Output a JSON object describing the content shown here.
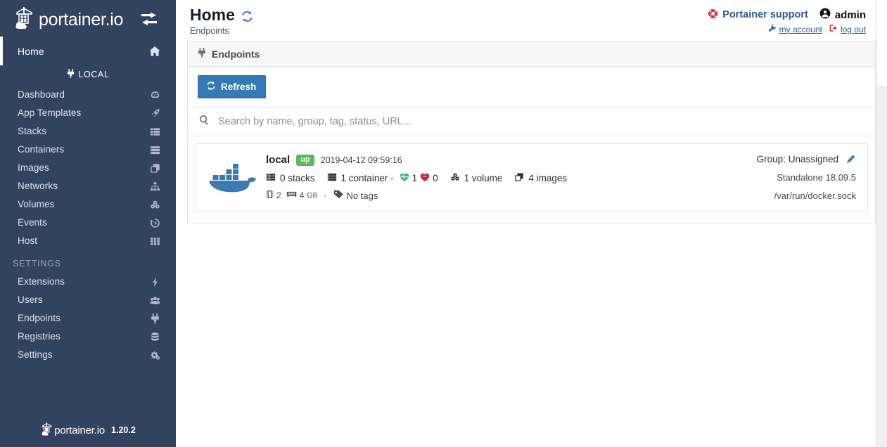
{
  "sidebar": {
    "brand": {
      "name": "portainer.io",
      "logo_icon": "portainer-crane-icon",
      "toggle_icon": "exchange-arrows-icon"
    },
    "home": {
      "label": "Home",
      "icon": "home-icon",
      "active": true
    },
    "local_section": {
      "label": "LOCAL",
      "icon": "plug-icon"
    },
    "items": [
      {
        "label": "Dashboard",
        "icon": "dashboard-gauge-icon"
      },
      {
        "label": "App Templates",
        "icon": "rocket-icon"
      },
      {
        "label": "Stacks",
        "icon": "th-list-icon"
      },
      {
        "label": "Containers",
        "icon": "server-icon"
      },
      {
        "label": "Images",
        "icon": "clone-layers-icon"
      },
      {
        "label": "Networks",
        "icon": "sitemap-icon"
      },
      {
        "label": "Volumes",
        "icon": "hdd-cubes-icon"
      },
      {
        "label": "Events",
        "icon": "history-clock-icon"
      },
      {
        "label": "Host",
        "icon": "th-grid-icon"
      }
    ],
    "settings_section": {
      "label": "SETTINGS"
    },
    "settings_items": [
      {
        "label": "Extensions",
        "icon": "bolt-icon"
      },
      {
        "label": "Users",
        "icon": "users-icon"
      },
      {
        "label": "Endpoints",
        "icon": "plug-icon"
      },
      {
        "label": "Registries",
        "icon": "database-icon"
      },
      {
        "label": "Settings",
        "icon": "cogs-icon"
      }
    ],
    "footer": {
      "name": "portainer.io",
      "version": "1.20.2",
      "logo_icon": "portainer-crane-icon"
    }
  },
  "header": {
    "title": "Home",
    "refresh_icon": "refresh-circular-arrows-icon",
    "subtitle": "Endpoints",
    "support_label": "Portainer support",
    "support_icon": "life-ring-icon",
    "user_name": "admin",
    "user_icon": "user-circle-icon",
    "my_account_label": "my account",
    "my_account_icon": "wrench-icon",
    "logout_label": "log out",
    "logout_icon": "sign-out-icon"
  },
  "panel": {
    "title": "Endpoints",
    "title_icon": "plug-icon",
    "refresh_button": {
      "label": "Refresh",
      "icon": "refresh-circular-arrows-icon"
    },
    "search": {
      "placeholder": "Search by name, group, tag, status, URL...",
      "value": "",
      "icon": "search-icon"
    }
  },
  "endpoints": [
    {
      "logo_icon": "docker-whale-icon",
      "name": "local",
      "status": "up",
      "timestamp": "2019-04-12 09:59:16",
      "stacks": {
        "text": "0 stacks",
        "icon": "th-list-icon"
      },
      "containers": {
        "text": "1 container -",
        "icon": "server-icon"
      },
      "containers_running": "1",
      "containers_running_icon": "heartbeat-green-icon",
      "containers_stopped": "0",
      "containers_stopped_icon": "heart-red-icon",
      "volumes": {
        "text": "1 volume",
        "icon": "hdd-cubes-icon"
      },
      "images": {
        "text": "4 images",
        "icon": "clone-layers-icon"
      },
      "cpu": {
        "text": "2",
        "icon": "microchip-icon"
      },
      "memory": {
        "text": "4",
        "unit": "GB",
        "icon": "memory-icon"
      },
      "separator": "-",
      "tags": {
        "text": "No tags",
        "icon": "tags-icon"
      },
      "group": "Group: Unassigned",
      "group_edit_icon": "pencil-edit-icon",
      "engine": "Standalone 18.09.5",
      "url": "/var/run/docker.sock"
    }
  ],
  "colors": {
    "sidebar_bg": "#32435f",
    "primary_blue": "#337ab7",
    "status_up_green": "#5cb85c",
    "support_red": "#d9363e",
    "link_blue": "#2f5b8e",
    "heart_green": "#3bb28f",
    "heart_red": "#c0272d"
  },
  "scrollbar": {
    "up_arrow_icon": "triangle-up-icon"
  }
}
